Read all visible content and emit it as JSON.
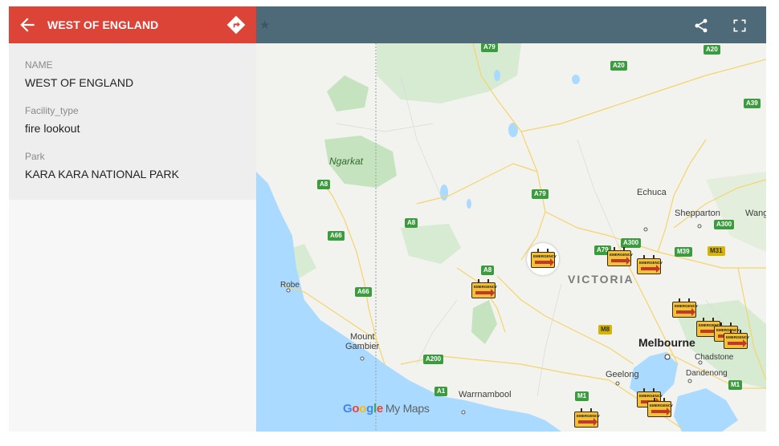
{
  "panel": {
    "title": "WEST OF ENGLAND",
    "fields": [
      {
        "label": "NAME",
        "value": "WEST OF ENGLAND"
      },
      {
        "label": "Facility_type",
        "value": "fire lookout"
      },
      {
        "label": "Park",
        "value": "KARA KARA NATIONAL PARK"
      }
    ]
  },
  "map": {
    "region_label": "VICTORIA",
    "park_label": "Ngarkat",
    "places": [
      "Echuca",
      "Shepparton",
      "Wang",
      "Robe",
      "Mount",
      "Gambier",
      "Melbourne",
      "Chadstone",
      "Dandenong",
      "Geelong",
      "Warrnambool"
    ],
    "roads": [
      "A79",
      "A20",
      "A20",
      "A39",
      "A8",
      "A79",
      "A8",
      "A66",
      "A8",
      "A79",
      "A300",
      "A300",
      "M39",
      "M31",
      "A66",
      "M8",
      "A200",
      "A1",
      "M1",
      "M1"
    ],
    "marker_label": "EMERGENCY",
    "attribution": {
      "google": [
        "G",
        "o",
        "o",
        "g",
        "l",
        "e"
      ],
      "product": "My Maps"
    }
  },
  "icons": {
    "back": "arrow-left-icon",
    "directions": "directions-icon",
    "star": "star-icon",
    "share": "share-icon",
    "fullscreen": "fullscreen-icon"
  },
  "colors": {
    "header_red": "#db4437",
    "map_bar": "#4e6a79",
    "water": "#aadaff",
    "park_green": "#c5e3bf",
    "marker_yellow": "#f3c136"
  }
}
